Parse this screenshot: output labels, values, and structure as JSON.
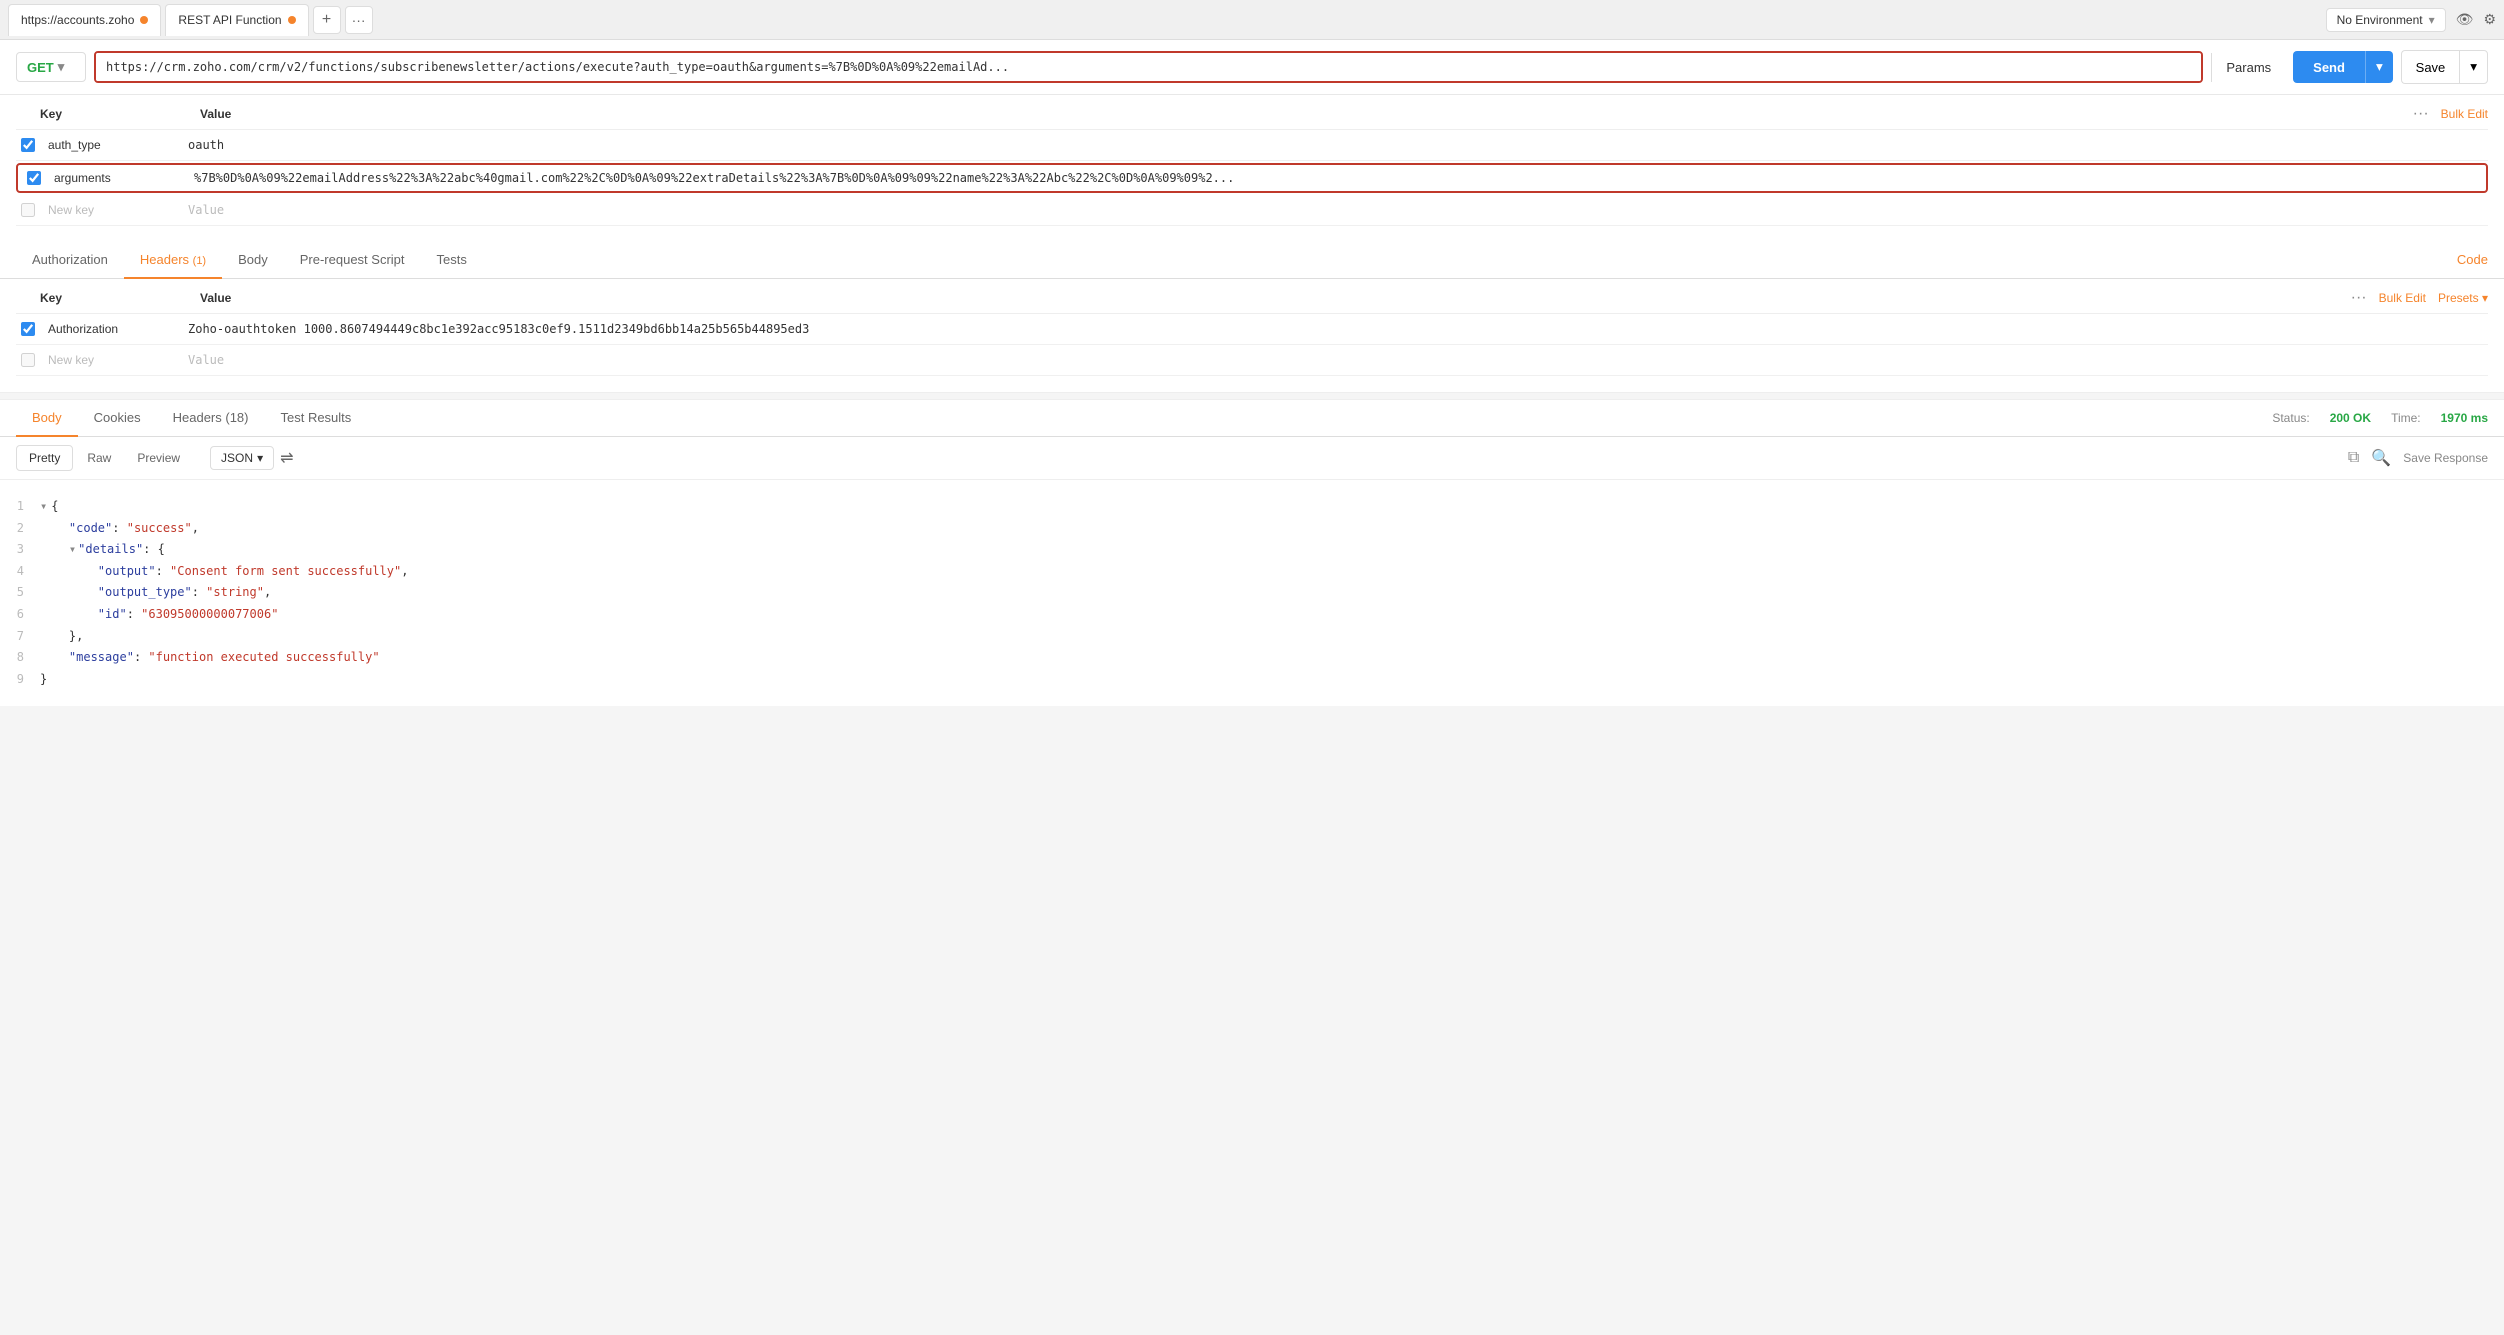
{
  "tabs": {
    "items": [
      {
        "label": "https://accounts.zoho",
        "dot": true
      },
      {
        "label": "REST API Function",
        "dot": true
      }
    ],
    "add_label": "+",
    "more_label": "···"
  },
  "env": {
    "selector_label": "No Environment",
    "eye_icon": "👁",
    "gear_icon": "⚙"
  },
  "request": {
    "method": "GET",
    "url": "https://crm.zoho.com/crm/v2/functions/subscribenewsletter/actions/execute?auth_type=oauth&arguments=%7B%0D%0A%09%22emailAd...",
    "params_label": "Params",
    "send_label": "Send",
    "save_label": "Save"
  },
  "params": {
    "key_header": "Key",
    "value_header": "Value",
    "bulk_edit_label": "Bulk Edit",
    "rows": [
      {
        "checked": true,
        "key": "auth_type",
        "value": "oauth",
        "highlighted": false
      },
      {
        "checked": true,
        "key": "arguments",
        "value": "%7B%0D%0A%09%22emailAddress%22%3A%22abc%40gmail.com%22%2C%0D%0A%09%22extraDetails%22%3A%7B%0D%0A%09%09%22name%22%3A%22Abc%22%2C%0D%0A%09%09%2...",
        "highlighted": true
      }
    ],
    "new_key_placeholder": "New key",
    "new_value_placeholder": "Value"
  },
  "request_tabs": {
    "items": [
      {
        "label": "Authorization",
        "active": false,
        "badge": ""
      },
      {
        "label": "Headers",
        "active": true,
        "badge": "(1)"
      },
      {
        "label": "Body",
        "active": false,
        "badge": ""
      },
      {
        "label": "Pre-request Script",
        "active": false,
        "badge": ""
      },
      {
        "label": "Tests",
        "active": false,
        "badge": ""
      }
    ],
    "code_label": "Code"
  },
  "headers": {
    "key_header": "Key",
    "value_header": "Value",
    "bulk_edit_label": "Bulk Edit",
    "presets_label": "Presets ▾",
    "rows": [
      {
        "checked": true,
        "key": "Authorization",
        "value": "Zoho-oauthtoken 1000.8607494449c8bc1e392acc95183c0ef9.1511d2349bd6bb14a25b565b44895ed3"
      }
    ],
    "new_key_placeholder": "New key",
    "new_value_placeholder": "Value"
  },
  "response_tabs": {
    "items": [
      {
        "label": "Body",
        "active": true
      },
      {
        "label": "Cookies",
        "active": false
      },
      {
        "label": "Headers (18)",
        "active": false
      },
      {
        "label": "Test Results",
        "active": false
      }
    ],
    "status_label": "Status:",
    "status_value": "200 OK",
    "time_label": "Time:",
    "time_value": "1970 ms"
  },
  "body_tabs": {
    "items": [
      {
        "label": "Pretty",
        "active": true
      },
      {
        "label": "Raw",
        "active": false
      },
      {
        "label": "Preview",
        "active": false
      }
    ],
    "format_label": "JSON",
    "save_response_label": "Save Response"
  },
  "code_content": {
    "lines": [
      {
        "num": "1",
        "content": "{",
        "type": "brace"
      },
      {
        "num": "2",
        "content": "    \"code\": \"success\",",
        "type": "kv_string"
      },
      {
        "num": "3",
        "content": "    \"details\": {",
        "type": "kv_brace"
      },
      {
        "num": "4",
        "content": "        \"output\": \"Consent form sent successfully\",",
        "type": "kv_string"
      },
      {
        "num": "5",
        "content": "        \"output_type\": \"string\",",
        "type": "kv_string"
      },
      {
        "num": "6",
        "content": "        \"id\": \"63095000000077006\"",
        "type": "kv_string"
      },
      {
        "num": "7",
        "content": "    },",
        "type": "brace"
      },
      {
        "num": "8",
        "content": "    \"message\": \"function executed successfully\"",
        "type": "kv_string"
      },
      {
        "num": "9",
        "content": "}",
        "type": "brace"
      }
    ]
  }
}
